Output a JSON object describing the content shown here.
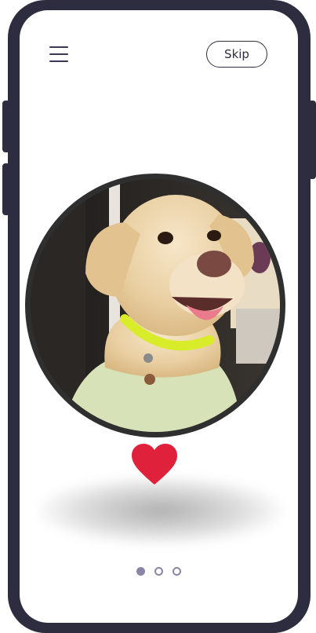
{
  "header": {
    "menu_icon": "hamburger-menu-icon",
    "skip_label": "Skip"
  },
  "main": {
    "photo_subject": "dog-photo",
    "like_icon": "heart-icon"
  },
  "pagination": {
    "total": 3,
    "active_index": 0
  },
  "colors": {
    "frame": "#2e2c3f",
    "heart": "#e0213b",
    "dot": "#8a87a6"
  }
}
